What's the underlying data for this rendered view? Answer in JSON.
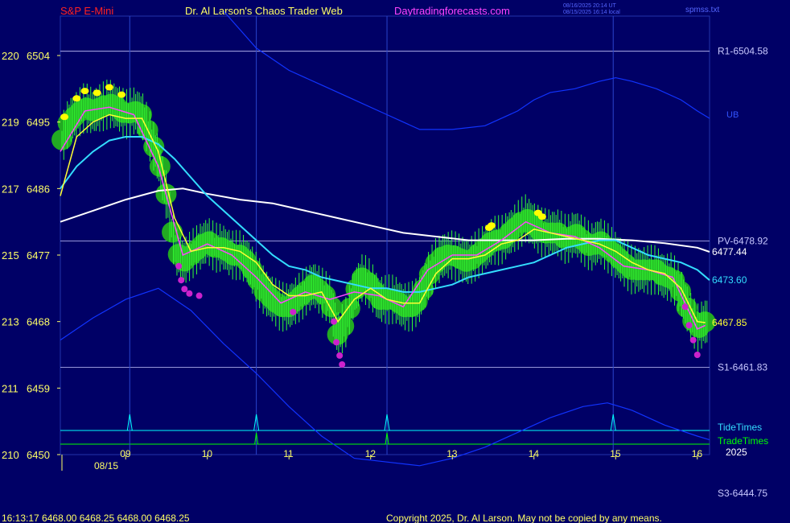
{
  "header": {
    "symbol": "S&P E-Mini",
    "site_title": "Dr. Al Larson's Chaos Trader Web",
    "url": "Daytradingforecasts.com",
    "utc_time": "08/16/2025 20:14 UT",
    "local_time": "08/15/2025 16:14 local",
    "file": "spmss.txt"
  },
  "footer": {
    "quote": "16:13:17  6468.00 6468.25 6468.00 6468.25",
    "copyright": "Copyright 2025, Dr. Al Larson. May not be copied by any means."
  },
  "colors": {
    "background": "#000066",
    "price_bars": "#33ff33",
    "cloud": "#22aa22",
    "fast_ma": "#ffff33",
    "mid_ma": "#ff44ff",
    "cyan_ma": "#33ddff",
    "white_ma": "#ffffff",
    "bands": "#1133ff",
    "green_text": "#00ff00",
    "cyan_text": "#00ffff",
    "magenta_dots": "#cc22cc",
    "yellow_dots": "#ffff00"
  },
  "chart_data": {
    "type": "line",
    "symbol": "S&P E-Mini",
    "date_label": "08/15",
    "year_label": "2025",
    "y_axis": {
      "min": 6450,
      "max": 6504,
      "ticks": [
        {
          "left": "210",
          "price": "6450",
          "value": 6450
        },
        {
          "left": "211",
          "price": "6459",
          "value": 6459
        },
        {
          "left": "213",
          "price": "6468",
          "value": 6468
        },
        {
          "left": "215",
          "price": "6477",
          "value": 6477
        },
        {
          "left": "217",
          "price": "6486",
          "value": 6486
        },
        {
          "left": "219",
          "price": "6495",
          "value": 6495
        },
        {
          "left": "220",
          "price": "6504",
          "value": 6504
        }
      ]
    },
    "x_axis": {
      "min": 8.2,
      "max": 16.15,
      "ticks": [
        {
          "label": "09",
          "value": 9
        },
        {
          "label": "10",
          "value": 10
        },
        {
          "label": "11",
          "value": 11
        },
        {
          "label": "12",
          "value": 12
        },
        {
          "label": "13",
          "value": 13
        },
        {
          "label": "14",
          "value": 14
        },
        {
          "label": "15",
          "value": 15
        },
        {
          "label": "16",
          "value": 16
        }
      ]
    },
    "levels": [
      {
        "label": "R1-6504.58",
        "value": 6504.58
      },
      {
        "label": "PV-6478.92",
        "value": 6478.92
      },
      {
        "label": "S1-6461.83",
        "value": 6461.83
      },
      {
        "label": "S3-6444.75",
        "value": 6444.75
      }
    ],
    "end_labels": [
      {
        "label": "6477.44",
        "value": 6477.44,
        "color": "#ffffff"
      },
      {
        "label": "6473.60",
        "value": 6473.6,
        "color": "#33ddff"
      },
      {
        "label": "6467.85",
        "value": 6467.85,
        "color": "#ffff33"
      }
    ],
    "band_label": "UB",
    "tide_label": "TideTimes",
    "trade_label": "TradeTimes",
    "tide_times": [
      9.05,
      10.6,
      12.2,
      14.97
    ],
    "trade_times": [
      10.6,
      12.2
    ],
    "series": [
      {
        "name": "price",
        "x": [
          8.2,
          8.3,
          8.4,
          8.5,
          8.6,
          8.7,
          8.8,
          8.9,
          9.0,
          9.1,
          9.2,
          9.3,
          9.4,
          9.5,
          9.6,
          9.7,
          9.8,
          9.9,
          10.0,
          10.1,
          10.2,
          10.3,
          10.4,
          10.5,
          10.6,
          10.7,
          10.8,
          10.9,
          11.0,
          11.1,
          11.2,
          11.3,
          11.4,
          11.5,
          11.6,
          11.7,
          11.8,
          11.9,
          12.0,
          12.1,
          12.2,
          12.3,
          12.4,
          12.5,
          12.6,
          12.7,
          12.8,
          12.9,
          13.0,
          13.1,
          13.2,
          13.3,
          13.4,
          13.5,
          13.6,
          13.7,
          13.8,
          13.9,
          14.0,
          14.1,
          14.2,
          14.3,
          14.4,
          14.5,
          14.6,
          14.7,
          14.8,
          14.9,
          15.0,
          15.1,
          15.2,
          15.3,
          15.4,
          15.5,
          15.6,
          15.7,
          15.8,
          15.9,
          16.0,
          16.1
        ],
        "values": [
          6492,
          6495,
          6496,
          6497,
          6496.5,
          6497,
          6497.5,
          6497,
          6496,
          6496.5,
          6496,
          6493,
          6490,
          6485,
          6478,
          6476,
          6477,
          6478,
          6479,
          6478,
          6478,
          6477,
          6477,
          6476,
          6474,
          6472,
          6471,
          6470,
          6470,
          6471,
          6472,
          6473,
          6472,
          6471,
          6466,
          6468,
          6472,
          6474,
          6473,
          6471,
          6471,
          6471,
          6470,
          6470,
          6471,
          6474,
          6476,
          6477,
          6477,
          6476.5,
          6476,
          6477,
          6478,
          6479,
          6479,
          6480,
          6481,
          6482,
          6481,
          6480,
          6480,
          6480,
          6479,
          6480,
          6479,
          6478,
          6479,
          6478,
          6477,
          6476,
          6475,
          6475,
          6475,
          6475,
          6474,
          6474,
          6472,
          6469,
          6467,
          6468
        ]
      },
      {
        "name": "fast",
        "x": [
          8.2,
          8.4,
          8.6,
          8.8,
          9.0,
          9.2,
          9.4,
          9.6,
          9.8,
          10.0,
          10.2,
          10.4,
          10.6,
          10.8,
          11.0,
          11.2,
          11.4,
          11.6,
          11.8,
          12.0,
          12.2,
          12.4,
          12.6,
          12.8,
          13.0,
          13.2,
          13.4,
          13.6,
          13.8,
          14.0,
          14.2,
          14.4,
          14.6,
          14.8,
          15.0,
          15.2,
          15.4,
          15.6,
          15.8,
          16.0,
          16.1
        ],
        "values": [
          6485,
          6493,
          6495,
          6496,
          6495.5,
          6495.5,
          6491,
          6482,
          6477.5,
          6478,
          6478,
          6477.5,
          6476,
          6473,
          6471.5,
          6471.5,
          6472,
          6468,
          6471,
          6472.5,
          6471,
          6470.5,
          6470.5,
          6474.5,
          6476.5,
          6476.5,
          6477,
          6478.5,
          6479,
          6480.5,
          6480,
          6479.5,
          6479,
          6478.5,
          6477.5,
          6476,
          6475,
          6474.5,
          6472.5,
          6468,
          6467.85
        ]
      },
      {
        "name": "mid",
        "x": [
          8.2,
          8.5,
          8.8,
          9.1,
          9.4,
          9.7,
          10.0,
          10.3,
          10.6,
          10.9,
          11.2,
          11.5,
          11.8,
          12.1,
          12.4,
          12.7,
          13.0,
          13.3,
          13.6,
          13.9,
          14.2,
          14.5,
          14.8,
          15.1,
          15.4,
          15.7,
          16.0,
          16.1
        ],
        "values": [
          6491,
          6496.5,
          6497,
          6496,
          6489,
          6477,
          6478.5,
          6477,
          6474,
          6470.5,
          6472,
          6471,
          6472,
          6471.5,
          6470,
          6475,
          6477,
          6477,
          6479,
          6481.5,
          6480,
          6479.5,
          6478,
          6475.5,
          6475,
          6474,
          6467,
          6467.5
        ]
      },
      {
        "name": "cyan",
        "x": [
          8.2,
          8.4,
          8.6,
          8.8,
          9.0,
          9.2,
          9.4,
          9.6,
          9.8,
          10.0,
          10.2,
          10.4,
          10.6,
          10.8,
          11.0,
          11.2,
          11.4,
          11.6,
          11.8,
          12.0,
          12.2,
          12.4,
          12.6,
          12.8,
          13.0,
          13.2,
          13.4,
          13.6,
          13.8,
          14.0,
          14.2,
          14.4,
          14.6,
          14.8,
          15.0,
          15.2,
          15.4,
          15.6,
          15.8,
          16.0,
          16.15
        ],
        "values": [
          6486,
          6489,
          6491,
          6492.5,
          6493,
          6493,
          6492,
          6490,
          6487.5,
          6485,
          6483,
          6481,
          6479,
          6477,
          6475.5,
          6475,
          6474,
          6473.5,
          6473,
          6472.5,
          6472.5,
          6472,
          6472,
          6472.5,
          6473,
          6474,
          6474.5,
          6475,
          6475.5,
          6476,
          6477,
          6478,
          6478.5,
          6479,
          6479,
          6478,
          6477,
          6476.5,
          6476,
          6475,
          6473.6
        ]
      },
      {
        "name": "white",
        "x": [
          8.2,
          8.6,
          9.0,
          9.4,
          9.7,
          10.0,
          10.4,
          10.8,
          11.2,
          11.6,
          12.0,
          12.4,
          12.8,
          13.2,
          13.6,
          14.0,
          14.4,
          14.8,
          15.2,
          15.6,
          16.0,
          16.15
        ],
        "values": [
          6481.5,
          6483,
          6484.5,
          6485.7,
          6486,
          6485.3,
          6484.5,
          6484,
          6483,
          6482,
          6481,
          6480,
          6479.5,
          6479,
          6479,
          6479,
          6479.2,
          6479.2,
          6479,
          6478.6,
          6478,
          6477.44
        ]
      },
      {
        "name": "upper band",
        "x": [
          10.2,
          10.6,
          11.0,
          11.4,
          11.8,
          12.2,
          12.6,
          13.0,
          13.4,
          13.8,
          14.0,
          14.2,
          14.5,
          14.8,
          15.0,
          15.2,
          15.5,
          15.8,
          16.0,
          16.15
        ],
        "values": [
          6510,
          6505,
          6502,
          6500,
          6498,
          6496,
          6494,
          6494,
          6494.5,
          6496.5,
          6498,
          6499,
          6499.5,
          6500.5,
          6501,
          6500.5,
          6499.5,
          6498,
          6496.5,
          6495.5
        ]
      },
      {
        "name": "lower band",
        "x": [
          8.2,
          8.6,
          9.0,
          9.4,
          9.8,
          10.2,
          10.6,
          11.0,
          11.4,
          11.8,
          12.2,
          12.6,
          13.0,
          13.4,
          13.8,
          14.2,
          14.6,
          14.9,
          15.2,
          15.6,
          16.0,
          16.15
        ],
        "values": [
          6465.5,
          6468.5,
          6471,
          6472.5,
          6469.5,
          6465,
          6461,
          6456.5,
          6452.5,
          6449.5,
          6449,
          6448.5,
          6449.5,
          6451,
          6453,
          6455,
          6456.5,
          6457,
          6456,
          6454,
          6452.5,
          6452
        ]
      }
    ]
  }
}
